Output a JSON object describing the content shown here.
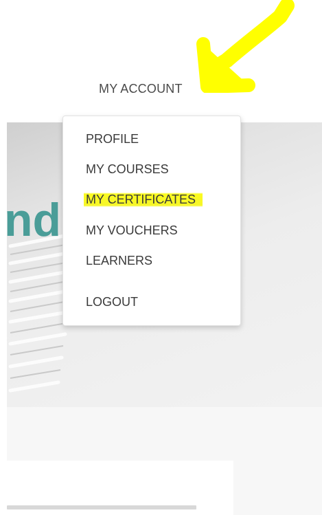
{
  "nav": {
    "account_label": "MY ACCOUNT"
  },
  "dropdown": {
    "items": [
      {
        "label": "PROFILE"
      },
      {
        "label": "MY COURSES"
      },
      {
        "label": "MY CERTIFICATES",
        "highlighted": true
      },
      {
        "label": "MY VOUCHERS"
      },
      {
        "label": "LEARNERS"
      },
      {
        "label": "LOGOUT"
      }
    ]
  },
  "hero": {
    "visible_text": "nd"
  },
  "colors": {
    "annotation_arrow": "#ffff00",
    "highlight": "#f8f81e",
    "hero_text": "#4a9d98",
    "menu_text": "#3a3a3a"
  }
}
